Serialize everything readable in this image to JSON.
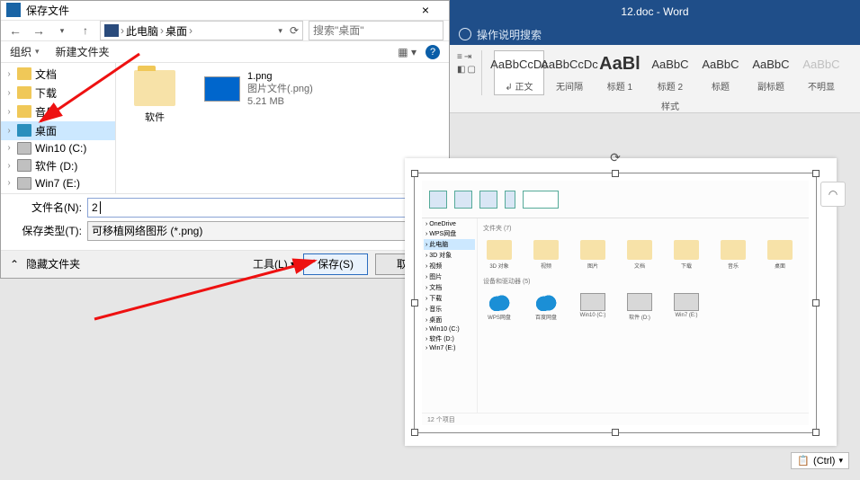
{
  "dialog": {
    "title": "保存文件",
    "breadcrumb": {
      "root": "此电脑",
      "loc": "桌面"
    },
    "search_placeholder": "搜索\"桌面\"",
    "toolbar": {
      "organize": "组织",
      "new_folder": "新建文件夹"
    },
    "tree": [
      {
        "label": "文档",
        "kind": "folder"
      },
      {
        "label": "下载",
        "kind": "folder"
      },
      {
        "label": "音乐",
        "kind": "folder"
      },
      {
        "label": "桌面",
        "kind": "desktop",
        "selected": true
      },
      {
        "label": "Win10 (C:)",
        "kind": "drive"
      },
      {
        "label": "软件 (D:)",
        "kind": "drive"
      },
      {
        "label": "Win7 (E:)",
        "kind": "drive"
      }
    ],
    "items": {
      "folder": {
        "name": "软件"
      },
      "file": {
        "name": "1.png",
        "type": "图片文件(.png)",
        "size": "5.21 MB"
      }
    },
    "filename_label": "文件名(N):",
    "filename_value": "2",
    "filetype_label": "保存类型(T):",
    "filetype_value": "可移植网络图形 (*.png)",
    "hide_folders": "隐藏文件夹",
    "tools": "工具(L)",
    "save": "保存(S)",
    "cancel": "取消"
  },
  "word": {
    "title": "12.doc  -  Word",
    "tell_me": "操作说明搜索",
    "styles_caption": "样式",
    "styles": [
      {
        "preview": "AaBbCcDc",
        "name": "正文",
        "sel": true
      },
      {
        "preview": "AaBbCcDc",
        "name": "无间隔"
      },
      {
        "preview": "AaBl",
        "name": "标题 1",
        "big": true
      },
      {
        "preview": "AaBbC",
        "name": "标题 2"
      },
      {
        "preview": "AaBbC",
        "name": "标题"
      },
      {
        "preview": "AaBbC",
        "name": "副标题"
      },
      {
        "preview": "AaBbC",
        "name": "不明显",
        "gray": true
      }
    ],
    "inner": {
      "section1": "文件夹 (7)",
      "grid1": [
        "3D 对象",
        "视频",
        "图片",
        "文档",
        "下载",
        "音乐",
        "桌面"
      ],
      "section2": "设备和驱动器 (5)",
      "grid2": [
        "WPS网盘",
        "百度网盘",
        "Win10 (C:)",
        "软件 (D:)",
        "Win7 (E:)"
      ],
      "tree": [
        "OneDrive",
        "WPS网盘",
        "此电脑",
        "3D 对象",
        "视频",
        "图片",
        "文档",
        "下载",
        "音乐",
        "桌面",
        "Win10 (C:)",
        "软件 (D:)",
        "Win7 (E:)"
      ],
      "status": "12 个项目"
    },
    "ctrl": "(Ctrl)"
  }
}
